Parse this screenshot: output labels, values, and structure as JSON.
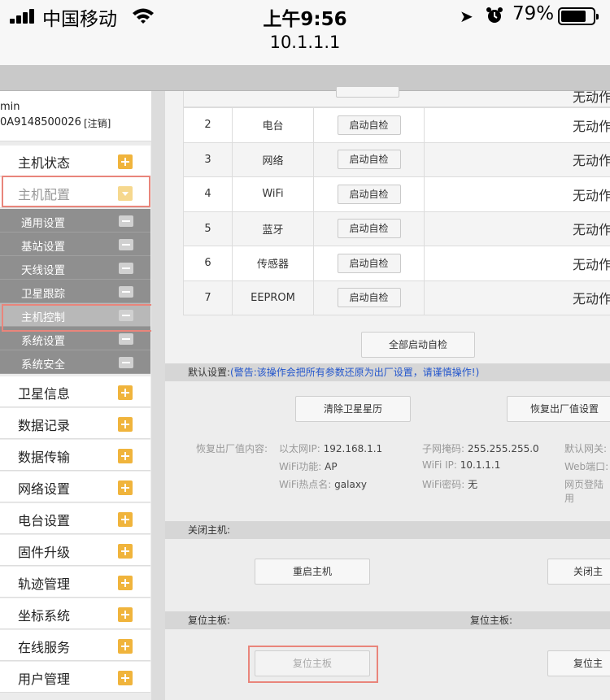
{
  "status": {
    "carrier": "中国移动",
    "time": "上午9:56",
    "battery": "79%",
    "battery_level": 0.79,
    "url": "10.1.1.1"
  },
  "user": {
    "name": "min",
    "id": "0A9148500026",
    "logout": "[注销]"
  },
  "menu": [
    {
      "label": "主机状态"
    },
    {
      "label": "主机配置"
    },
    {
      "label": "卫星信息"
    },
    {
      "label": "数据记录"
    },
    {
      "label": "数据传输"
    },
    {
      "label": "网络设置"
    },
    {
      "label": "电台设置"
    },
    {
      "label": "固件升级"
    },
    {
      "label": "轨迹管理"
    },
    {
      "label": "坐标系统"
    },
    {
      "label": "在线服务"
    },
    {
      "label": "用户管理"
    }
  ],
  "submenu": [
    "通用设置",
    "基站设置",
    "天线设置",
    "卫星跟踪",
    "主机控制",
    "系统设置",
    "系统安全"
  ],
  "selftest": {
    "rows": [
      {
        "no": "2",
        "name": "电台",
        "btn": "启动自检",
        "status": "无动作"
      },
      {
        "no": "3",
        "name": "网络",
        "btn": "启动自检",
        "status": "无动作"
      },
      {
        "no": "4",
        "name": "WiFi",
        "btn": "启动自检",
        "status": "无动作"
      },
      {
        "no": "5",
        "name": "蓝牙",
        "btn": "启动自检",
        "status": "无动作"
      },
      {
        "no": "6",
        "name": "传感器",
        "btn": "启动自检",
        "status": "无动作"
      },
      {
        "no": "7",
        "name": "EEPROM",
        "btn": "启动自检",
        "status": "无动作"
      }
    ],
    "partial_status": "无动作",
    "all_btn": "全部启动自检"
  },
  "defaults": {
    "header": "默认设置:",
    "warning": "(警告:该操作会把所有参数还原为出厂设置，请谨慎操作!)",
    "clear_btn": "清除卫星星历",
    "restore_btn": "恢复出厂值设置",
    "content_label": "恢复出厂值内容:",
    "eth_label": "以太网IP:",
    "eth": "192.168.1.1",
    "mask_label": "子网掩码:",
    "mask": "255.255.255.0",
    "gw": "默认网关:",
    "wifi_func_label": "WiFi功能:",
    "wifi_func": "AP",
    "wifi_ip_label": "WiFi IP:",
    "wifi_ip": "10.1.1.1",
    "web_port": "Web端口:",
    "hotspot_label": "WiFi热点名:",
    "hotspot": "galaxy",
    "wifi_pwd_label": "WiFi密码:",
    "wifi_pwd": "无",
    "web_login": "网页登陆用"
  },
  "shutdown": {
    "header": "关闭主机:",
    "reboot_btn": "重启主机",
    "off_btn": "关闭主"
  },
  "reset": {
    "header1": "复位主板:",
    "header2": "复位主板:",
    "btn1": "复位主板",
    "btn2": "复位主"
  }
}
